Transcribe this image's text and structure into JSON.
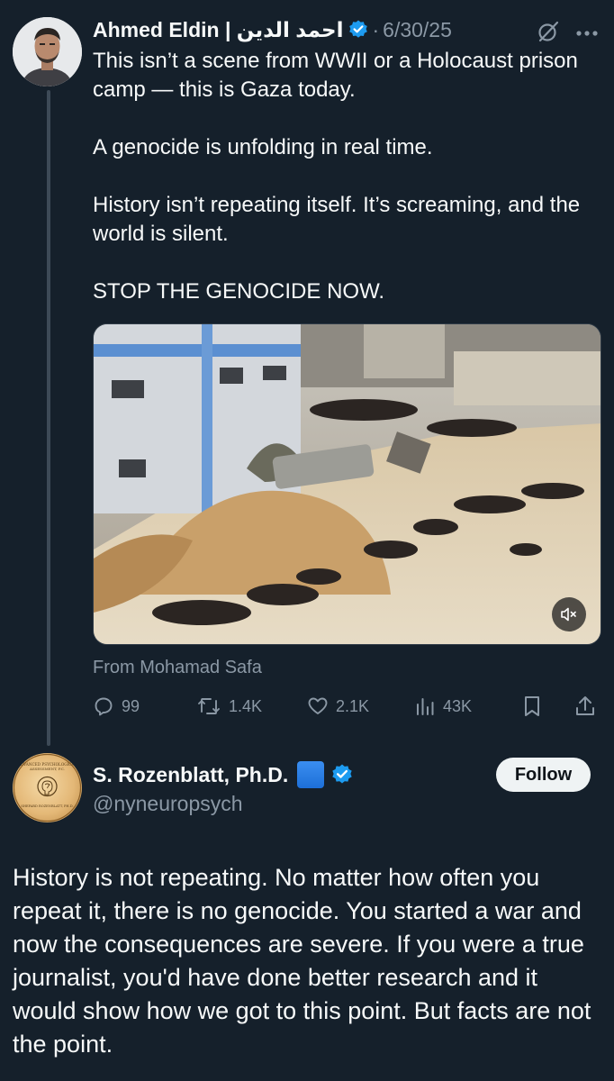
{
  "tweet": {
    "author_name": "Ahmed Eldin | احمد الدين",
    "separator": "·",
    "date": "6/30/25",
    "text_lines": [
      "This isn’t a scene from WWII or a Holocaust prison camp — this is Gaza today.",
      "A genocide is unfolding in real time.",
      "History isn’t repeating itself. It’s screaming, and the world is silent.",
      "STOP THE GENOCIDE NOW."
    ],
    "media_attribution": "From Mohamad Safa",
    "stats": {
      "replies": "99",
      "reposts": "1.4K",
      "likes": "2.1K",
      "views": "43K"
    },
    "icons": [
      "verified-badge-icon",
      "grok-icon",
      "more-icon",
      "mute-icon",
      "reply-icon",
      "repost-icon",
      "like-icon",
      "views-icon",
      "bookmark-icon",
      "share-icon"
    ]
  },
  "reply": {
    "author_name": "S. Rozenblatt, Ph.D.",
    "handle": "@nyneuropsych",
    "follow_label": "Follow",
    "avatar_text": [
      "ADVANCED PSYCHOLOGICAL",
      "ASSESSMENT, P.C.",
      "SHEPARD ROZENBLATT, PH.D."
    ],
    "text": "History is not repeating. No matter how often you repeat it, there is no genocide. You started a war and now the consequences are severe. If you were a true journalist, you'd have done better research and it would show how we got to this point. But facts are not the point."
  },
  "colors": {
    "background": "#15202b",
    "text_primary": "#f7f9f9",
    "text_secondary": "#8b98a5",
    "verified_blue": "#1d9bf0",
    "thread_line": "#3d4a57"
  }
}
